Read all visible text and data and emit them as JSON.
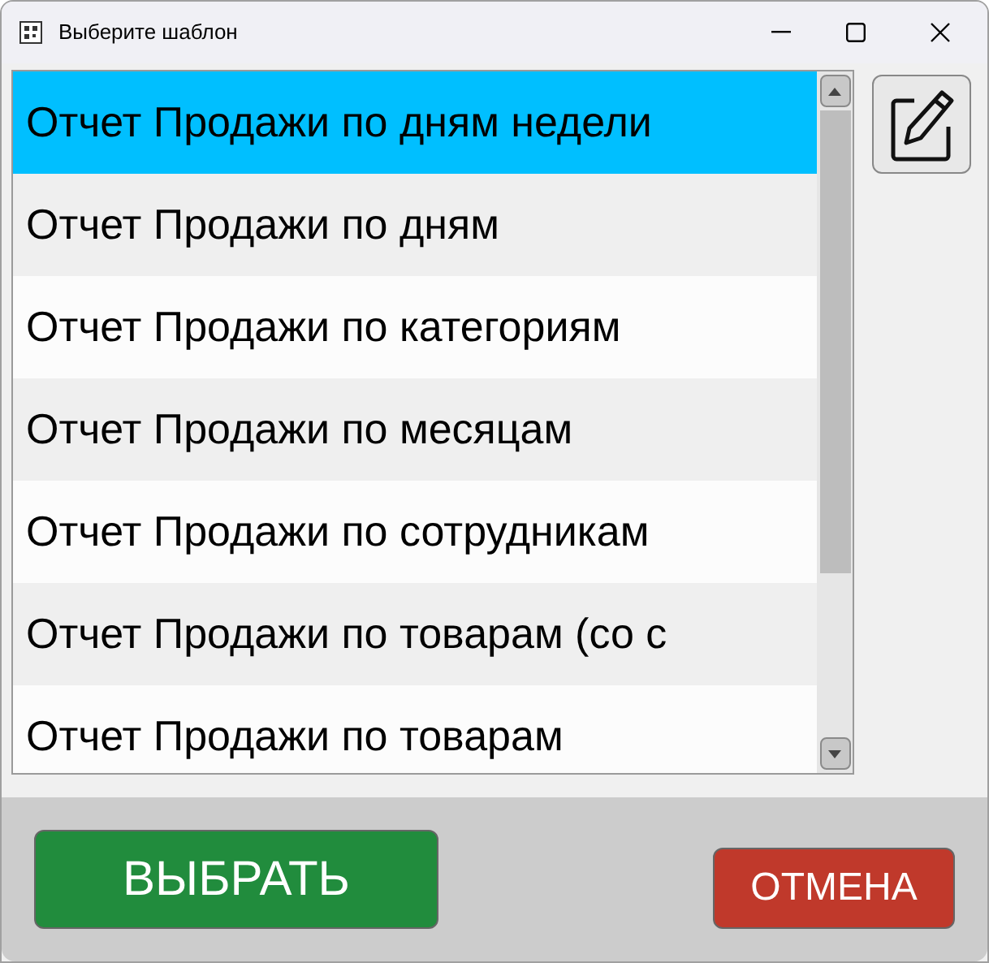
{
  "window": {
    "title": "Выберите шаблон"
  },
  "templates": [
    {
      "label": "Отчет Продажи по дням недели",
      "selected": true
    },
    {
      "label": "Отчет Продажи по дням",
      "selected": false
    },
    {
      "label": "Отчет Продажи по категориям",
      "selected": false
    },
    {
      "label": "Отчет Продажи по месяцам",
      "selected": false
    },
    {
      "label": "Отчет Продажи по сотрудникам",
      "selected": false
    },
    {
      "label": "Отчет Продажи по товарам (со с",
      "selected": false
    },
    {
      "label": "Отчет Продажи по товарам",
      "selected": false
    }
  ],
  "buttons": {
    "select": "ВЫБРАТЬ",
    "cancel": "ОТМЕНА"
  }
}
